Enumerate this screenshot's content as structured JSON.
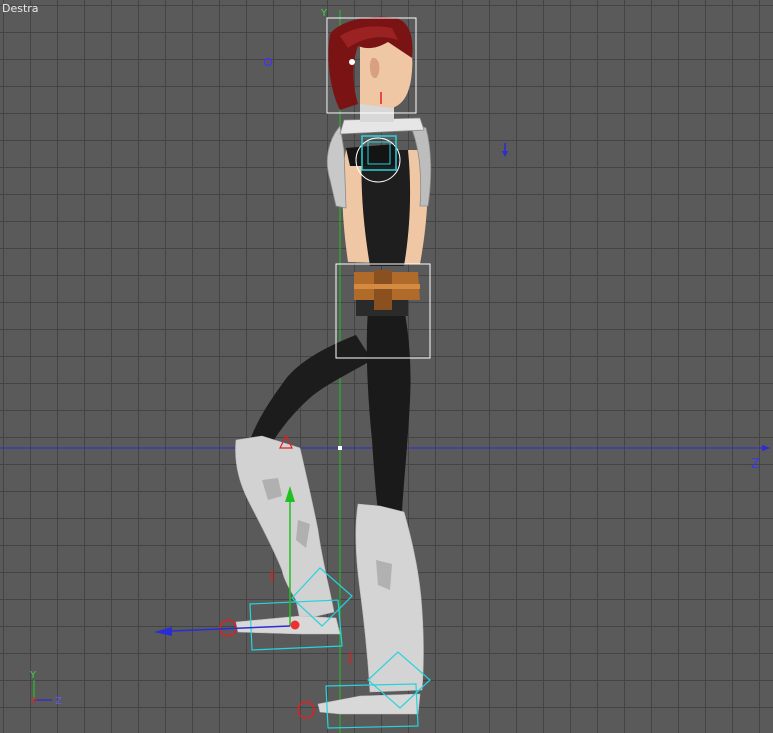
{
  "viewport": {
    "label": "Destra",
    "horizontal_axis_letter": "Z",
    "vertical_axis_letter": "Y",
    "gizmo": {
      "up": "Y",
      "right": "Z"
    }
  },
  "colors": {
    "grid_bg": "#5a5a5a",
    "grid_line": "#444444",
    "z_axis": "#2b2bd8",
    "y_axis": "#21c021",
    "selection_box": "#ffffff",
    "ik_handle": "#26d3dc",
    "hair": "#7a1414",
    "skin": "#f0c7a4",
    "suit": "#232323",
    "boots": "#d8d8d8",
    "belt": "#b36b2a"
  },
  "icons": [
    "light-target-icon",
    "camera-target-icon",
    "move-gizmo-icon",
    "axis-gizmo-icon"
  ]
}
